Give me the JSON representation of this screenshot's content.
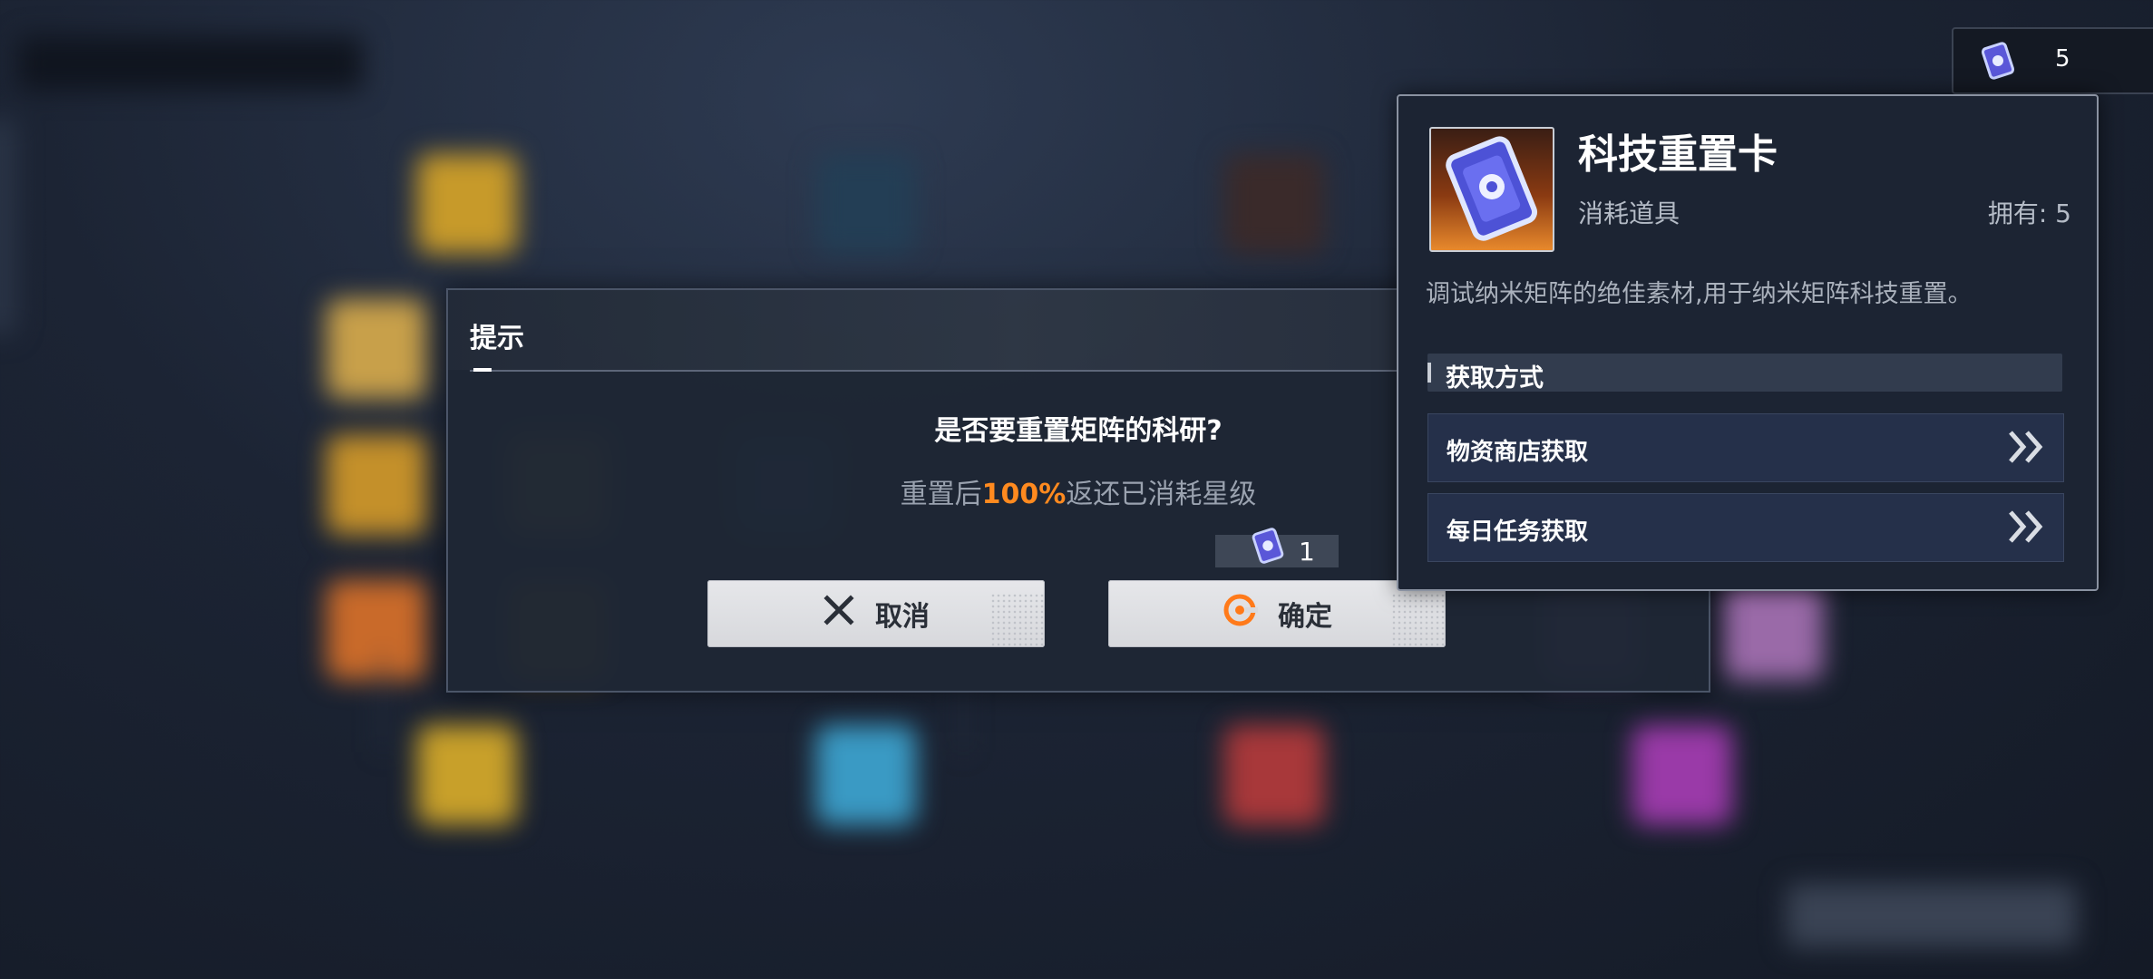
{
  "counter": {
    "icon": "tech-reset-card-icon",
    "value": "5"
  },
  "dialog": {
    "title": "提示",
    "question": "是否要重置矩阵的科研?",
    "sub_prefix": "重置后",
    "sub_highlight": "100%",
    "sub_suffix": "返还已消耗星级",
    "cost_value": "1",
    "cancel_label": "取消",
    "confirm_label": "确定"
  },
  "item": {
    "name": "科技重置卡",
    "type": "消耗道具",
    "own": "拥有: 5",
    "description": "调试纳米矩阵的绝佳素材,用于纳米矩阵科技重置。",
    "sources_header": "获取方式",
    "sources": [
      {
        "label": "物资商店获取"
      },
      {
        "label": "每日任务获取"
      }
    ]
  },
  "colors": {
    "highlight": "#ff8a1f",
    "panel_border": "#8a92a1",
    "dialog_bg": "#1e2634"
  }
}
